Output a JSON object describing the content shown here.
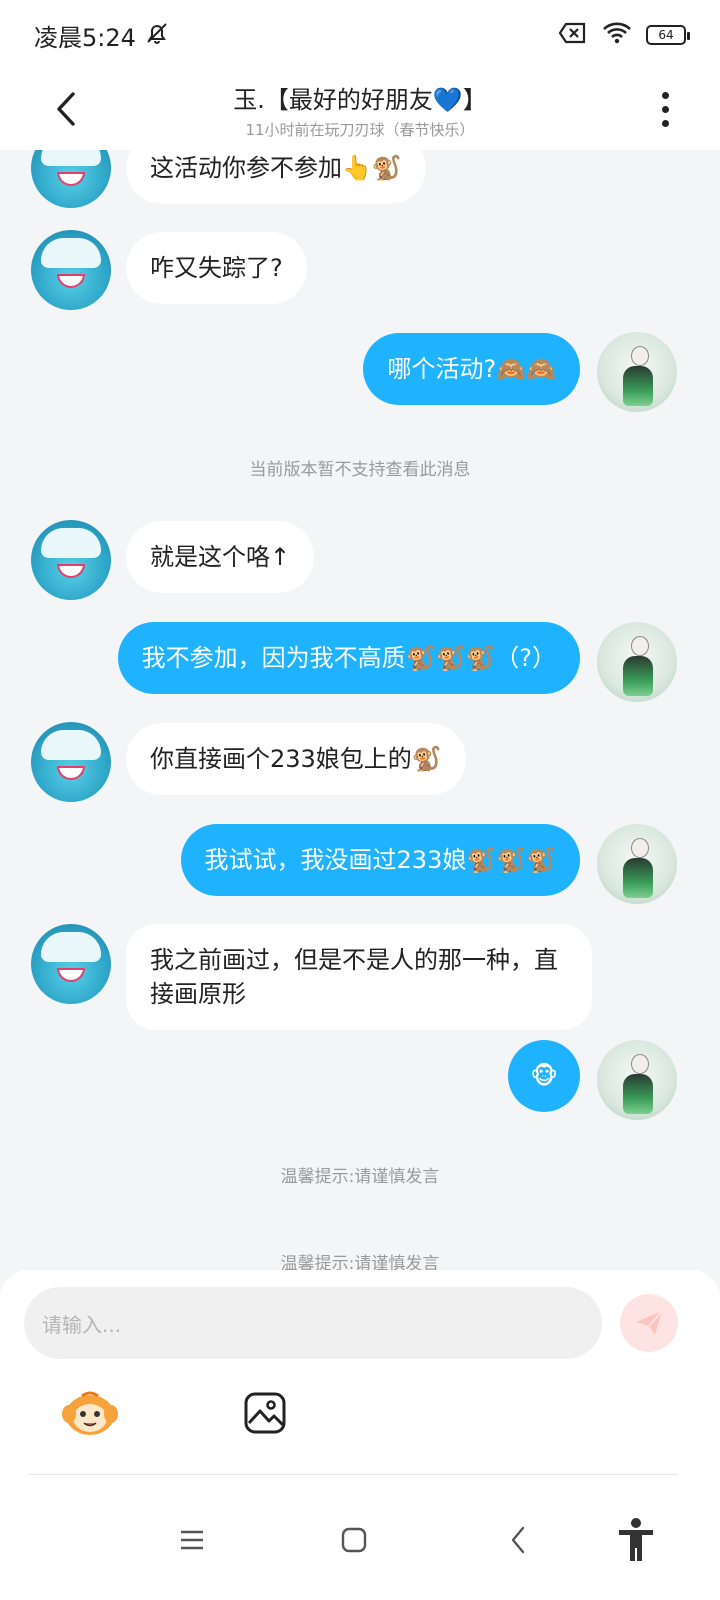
{
  "status": {
    "time": "凌晨5:24",
    "battery": "64"
  },
  "header": {
    "title": "玉.【最好的好朋友💙】",
    "subtitle": "11小时前在玩刀刃球（春节快乐）"
  },
  "messages": {
    "m1": "这活动你参不参加👆🐒",
    "m2": "咋又失踪了?",
    "m3": "哪个活动?🙈🙈",
    "sys1": "当前版本暂不支持查看此消息",
    "m4": "就是这个咯↑",
    "m5": "我不参加，因为我不高质🐒🐒🐒（?）",
    "m6": "你直接画个233娘包上的🐒",
    "m7": "我试试，我没画过233娘🐒🐒🐒",
    "m8": "我之前画过，但是不是人的那一种，直接画原形",
    "m9": "🐵",
    "sys2": "温馨提示:请谨慎发言",
    "sys3": "温馨提示:请谨慎发言"
  },
  "input": {
    "placeholder": "请输入..."
  },
  "icons": {
    "back": "chevron-left-icon",
    "more": "more-vertical-icon",
    "send": "send-icon",
    "emoji": "emoji-icon",
    "image": "image-icon",
    "nav_menu": "menu-icon",
    "nav_home": "home-square-icon",
    "nav_back": "back-icon",
    "accessibility": "accessibility-icon"
  },
  "colors": {
    "accent": "#1fb2ff",
    "send_bg": "#fde4e2",
    "background": "#f3f5f7"
  }
}
